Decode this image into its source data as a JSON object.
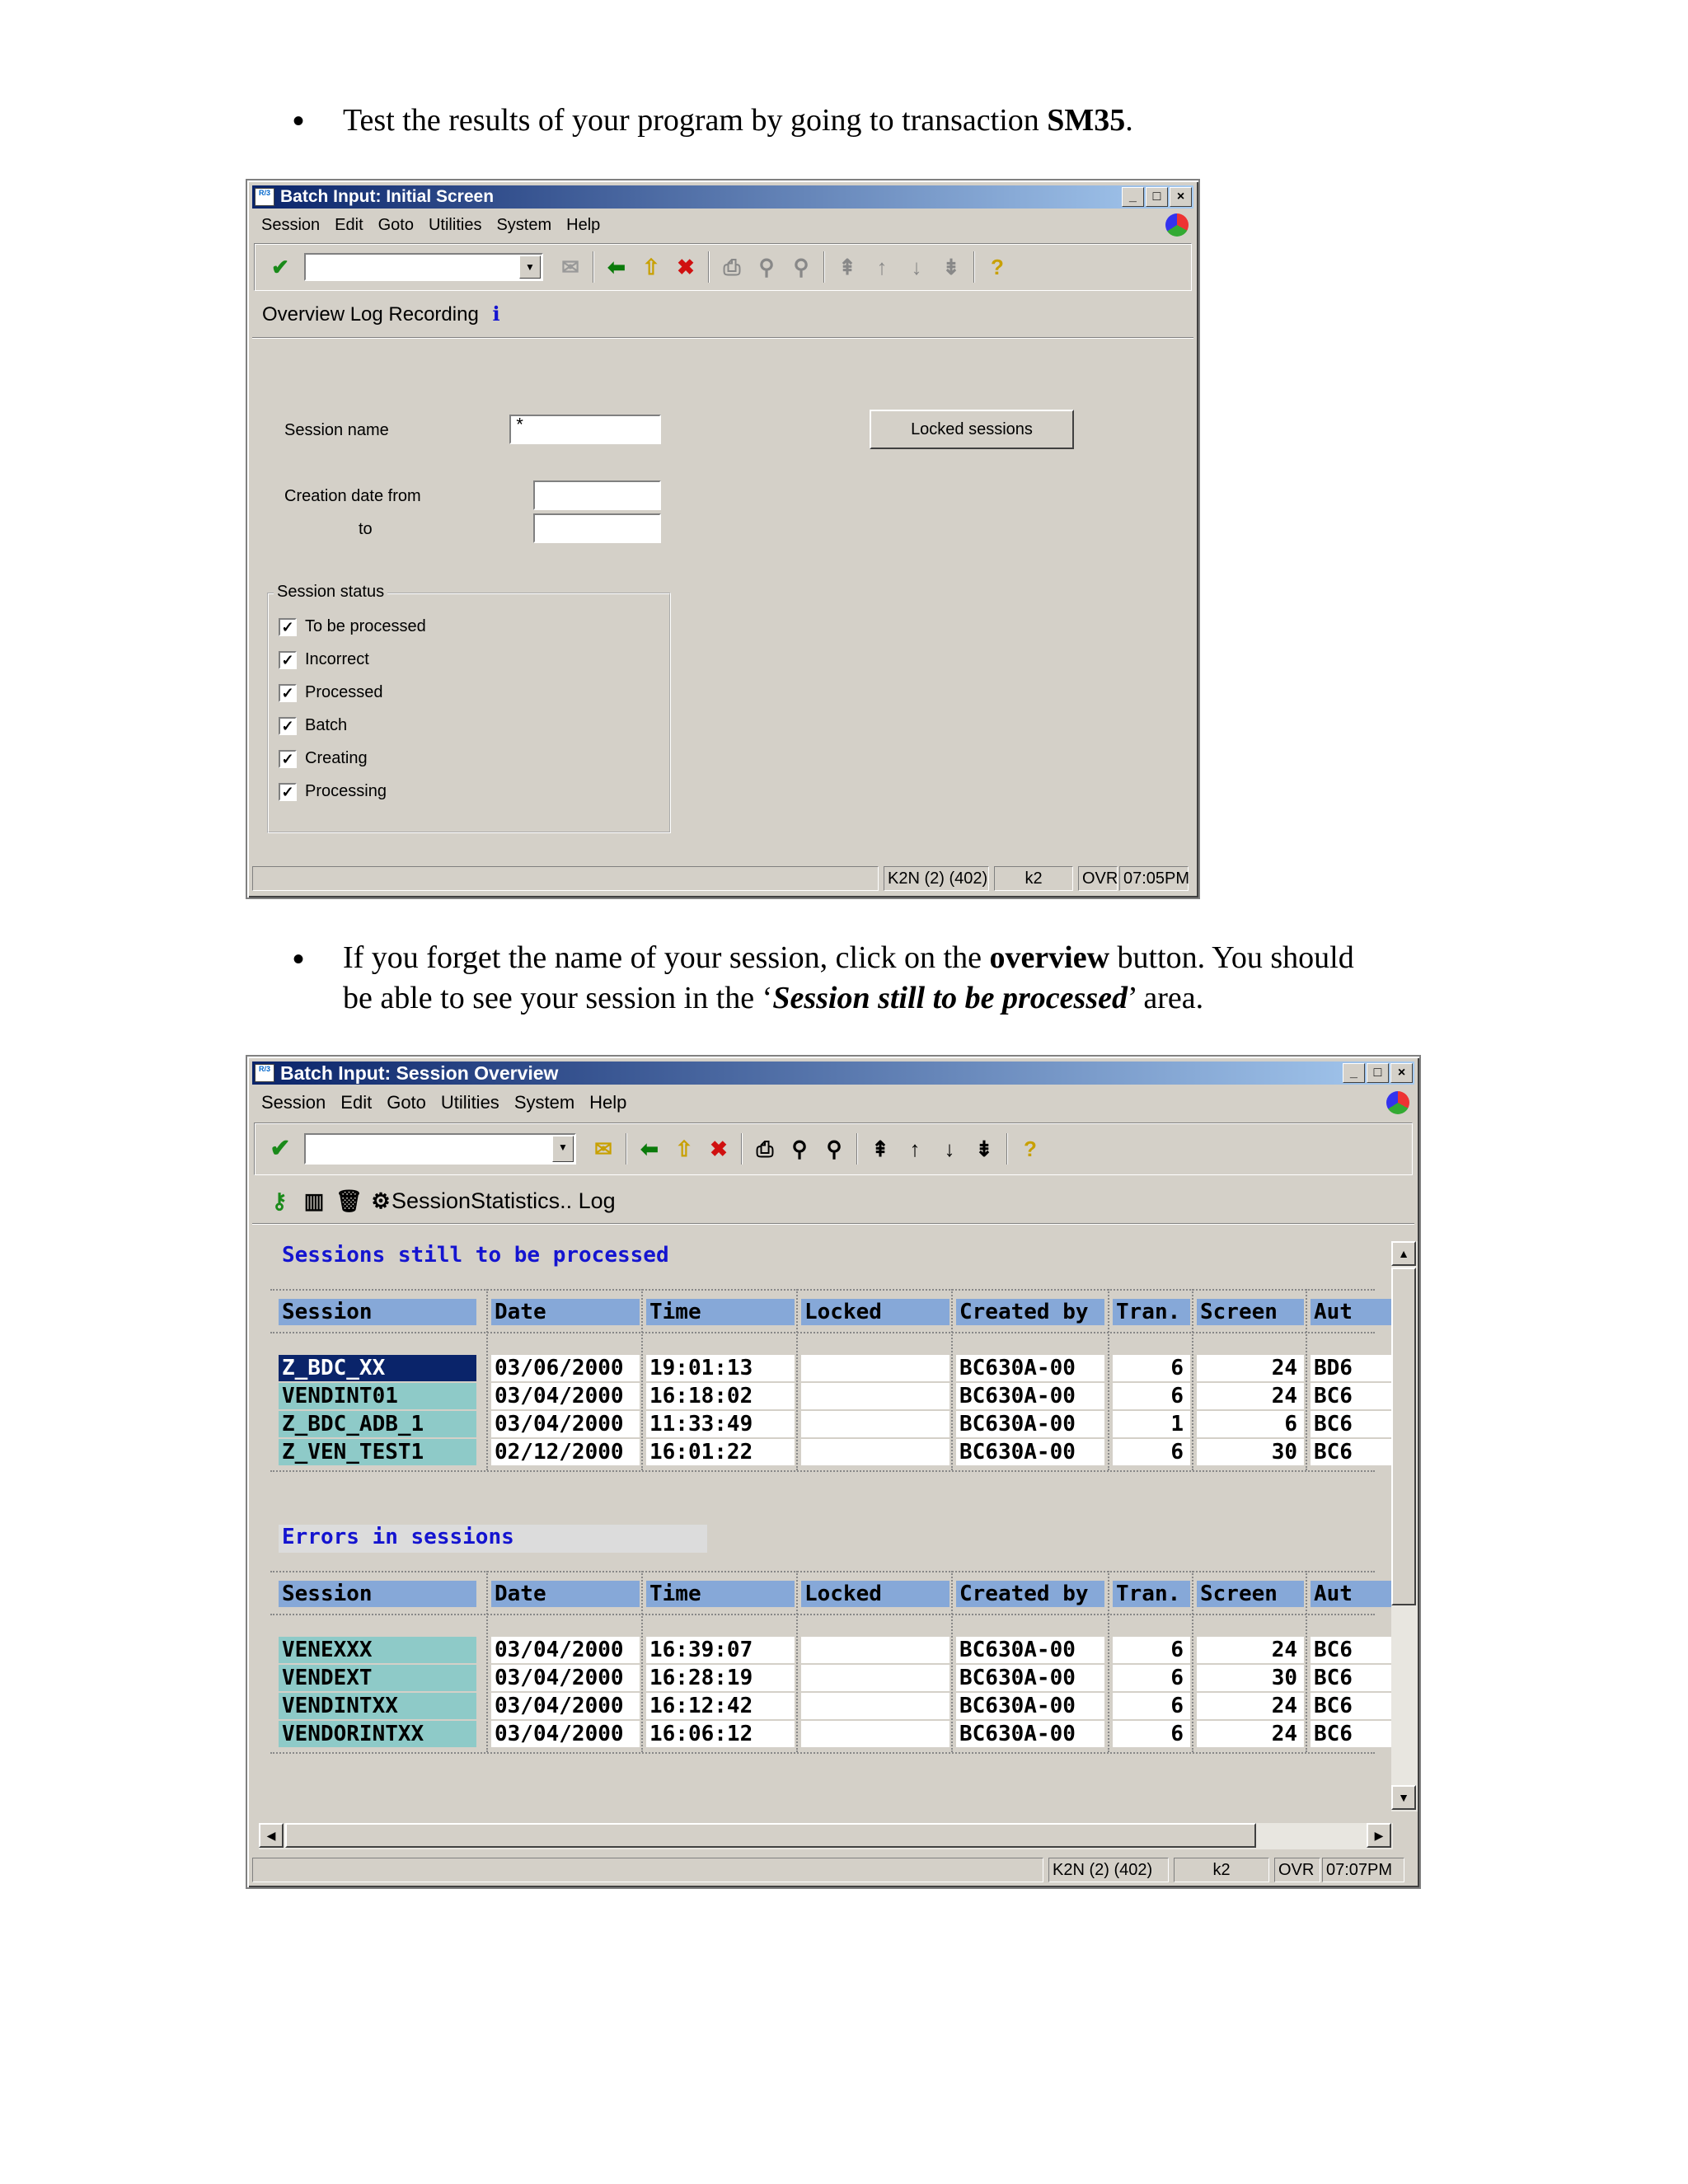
{
  "doc": {
    "bullet1_a": "Test the results of your program by going to transaction ",
    "bullet1_b": "SM35",
    "bullet1_c": ".",
    "bullet2_a": "If you forget the name of your session, click on the ",
    "bullet2_b": "overview",
    "bullet2_c": " button.  You should",
    "bullet2_d": "be able to see your session in the ‘",
    "bullet2_e": "Session still to be processed",
    "bullet2_f": "’ area.",
    "bullet_char": "•"
  },
  "win1": {
    "title": "Batch Input: Initial Screen",
    "menu": [
      "Session",
      "Edit",
      "Goto",
      "Utilities",
      "System",
      "Help"
    ],
    "toolbar_icons": [
      "enter-icon",
      "save-icon",
      "back-icon",
      "exit-icon",
      "cancel-icon",
      "print-icon",
      "find-icon",
      "find-next-icon",
      "first-page-icon",
      "prev-page-icon",
      "next-page-icon",
      "last-page-icon",
      "help-icon"
    ],
    "app_toolbar": "Overview Log Recording",
    "session_name_label": "Session name",
    "session_name_value": "*",
    "creation_date_from_label": "Creation date from",
    "to_label": "to",
    "locked_sessions_button": "Locked sessions",
    "group_title": "Session status",
    "statuses": [
      "To be processed",
      "Incorrect",
      "Processed",
      "Batch",
      "Creating",
      "Processing"
    ],
    "status_bar": {
      "system": "K2N (2) (402)",
      "server": "k2",
      "mode": "OVR",
      "time": "07:05PM"
    }
  },
  "win2": {
    "title": "Batch Input: Session Overview",
    "menu": [
      "Session",
      "Edit",
      "Goto",
      "Utilities",
      "System",
      "Help"
    ],
    "app_toolbar_text": "SessionStatistics.. Log",
    "section1": "Sessions still to be processed",
    "section2": "Errors in sessions",
    "columns": [
      "Session",
      "Date",
      "Time",
      "Locked",
      "Created by",
      "Tran.",
      "Screen",
      "Aut"
    ],
    "rows1": [
      [
        "Z_BDC_XX",
        "03/06/2000",
        "19:01:13",
        "",
        "BC630A-00",
        "6",
        "24",
        "BD6"
      ],
      [
        "VENDINT01",
        "03/04/2000",
        "16:18:02",
        "",
        "BC630A-00",
        "6",
        "24",
        "BC6"
      ],
      [
        "Z_BDC_ADB_1",
        "03/04/2000",
        "11:33:49",
        "",
        "BC630A-00",
        "1",
        "6",
        "BC6"
      ],
      [
        "Z_VEN_TEST1",
        "02/12/2000",
        "16:01:22",
        "",
        "BC630A-00",
        "6",
        "30",
        "BC6"
      ]
    ],
    "rows2": [
      [
        "VENEXXX",
        "03/04/2000",
        "16:39:07",
        "",
        "BC630A-00",
        "6",
        "24",
        "BC6"
      ],
      [
        "VENDEXT",
        "03/04/2000",
        "16:28:19",
        "",
        "BC630A-00",
        "6",
        "30",
        "BC6"
      ],
      [
        "VENDINTXX",
        "03/04/2000",
        "16:12:42",
        "",
        "BC630A-00",
        "6",
        "24",
        "BC6"
      ],
      [
        "VENDORINTXX",
        "03/04/2000",
        "16:06:12",
        "",
        "BC630A-00",
        "6",
        "24",
        "BC6"
      ]
    ],
    "status_bar": {
      "system": "K2N (2) (402)",
      "server": "k2",
      "mode": "OVR",
      "time": "07:07PM"
    }
  }
}
